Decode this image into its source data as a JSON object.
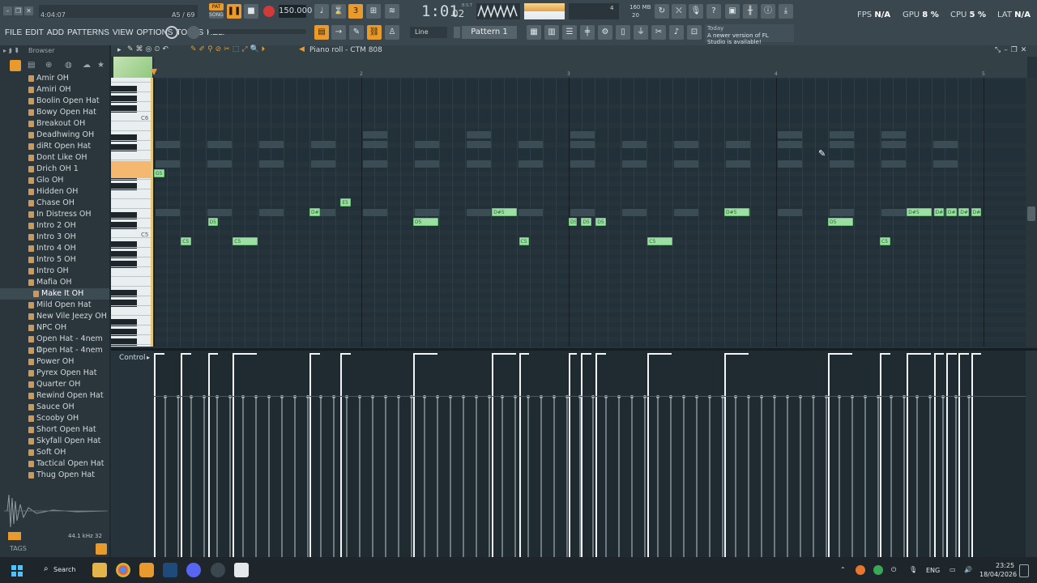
{
  "window": {
    "time_elapsed": "4:04:07",
    "hint_count": "A5 / 69"
  },
  "transport": {
    "pat_label": "PAT",
    "song_label": "SONG",
    "bpm": "150.000",
    "time": "1:01",
    "time_sub": "02",
    "time_hint": "B:S:T",
    "memory": "160 MB",
    "poly": "20",
    "cpu_meter": "4"
  },
  "menu": [
    "FILE",
    "EDIT",
    "ADD",
    "PATTERNS",
    "VIEW",
    "OPTIONS",
    "TOOLS",
    "HELP"
  ],
  "toolbar": {
    "snap": "Line",
    "pattern": "Pattern 1",
    "news_title": "Today",
    "news_text": "A newer version of FL Studio is available!"
  },
  "stats": {
    "fps_label": "FPS",
    "fps": "N/A",
    "gpu_label": "GPU",
    "gpu": "8 %",
    "cpu_label": "CPU",
    "cpu": "5 %",
    "lat_label": "LAT",
    "lat": "N/A"
  },
  "browser": {
    "title": "Browser",
    "items": [
      "Amir OH",
      "Amiri OH",
      "Boolin Open Hat",
      "Bowy Open Hat",
      "Breakout OH",
      "Deadhwing OH",
      "diRt Open Hat",
      "Dont Like OH",
      "Drich OH 1",
      "Glo OH",
      "Hidden OH",
      "Chase OH",
      "In Distress OH",
      "Intro 2 OH",
      "Intro 3 OH",
      "Intro 4 OH",
      "Intro 5 OH",
      "Intro OH",
      "Mafia OH",
      "Make It OH",
      "Mild Open Hat",
      "New Vile Jeezy OH",
      "NPC OH",
      "Open Hat - 4nem II",
      "Open Hat - 4nem",
      "Power OH",
      "Pyrex Open Hat",
      "Quarter OH",
      "Rewind Open Hat",
      "Sauce OH",
      "Scooby OH",
      "Short Open Hat",
      "Skyfall Open Hat",
      "Soft OH",
      "Tactical Open Hat",
      "Thug Open Hat"
    ],
    "selected_index": 19,
    "sample_info": "44.1 kHz 32",
    "tags_label": "TAGS"
  },
  "piano_roll": {
    "title": "Piano roll - CTM 808",
    "bar_numbers": [
      "2",
      "3",
      "4",
      "5"
    ],
    "key_labels": [
      "C6",
      "C5"
    ],
    "control_label": "Control",
    "notes": [
      {
        "label": "G5",
        "pitch": "G5",
        "start": 1.0,
        "len": 0.05
      },
      {
        "label": "D#5",
        "pitch": "D#5",
        "start": 1.75,
        "len": 0.05
      },
      {
        "label": "E5",
        "pitch": "E5",
        "start": 1.9,
        "len": 0.05
      },
      {
        "label": "D5",
        "pitch": "D5",
        "start": 1.26,
        "len": 0.05
      },
      {
        "label": "C5",
        "pitch": "C5",
        "start": 1.13,
        "len": 0.05
      },
      {
        "label": "C5",
        "pitch": "C5",
        "start": 1.38,
        "len": 0.12
      },
      {
        "label": "D5",
        "pitch": "D5",
        "start": 2.25,
        "len": 0.12
      },
      {
        "label": "D#5",
        "pitch": "D#5",
        "start": 2.63,
        "len": 0.12
      },
      {
        "label": "C5",
        "pitch": "C5",
        "start": 2.76,
        "len": 0.05
      },
      {
        "label": "D5",
        "pitch": "D5",
        "start": 3.0,
        "len": 0.02
      },
      {
        "label": "D5",
        "pitch": "D5",
        "start": 3.06,
        "len": 0.05
      },
      {
        "label": "D5",
        "pitch": "D5",
        "start": 3.13,
        "len": 0.05
      },
      {
        "label": "C5",
        "pitch": "C5",
        "start": 3.38,
        "len": 0.12
      },
      {
        "label": "D#5",
        "pitch": "D#5",
        "start": 3.75,
        "len": 0.12
      },
      {
        "label": "D5",
        "pitch": "D5",
        "start": 4.25,
        "len": 0.12
      },
      {
        "label": "C5",
        "pitch": "C5",
        "start": 4.5,
        "len": 0.05
      },
      {
        "label": "D#5",
        "pitch": "D#5",
        "start": 4.63,
        "len": 0.12
      },
      {
        "label": "D#5",
        "pitch": "D#5",
        "start": 4.76,
        "len": 0.05
      },
      {
        "label": "D#5",
        "pitch": "D#5",
        "start": 4.82,
        "len": 0.05
      },
      {
        "label": "D#5",
        "pitch": "D#5",
        "start": 4.88,
        "len": 0.05
      },
      {
        "label": "D#5",
        "pitch": "D#5",
        "start": 4.94,
        "len": 0.05
      }
    ]
  },
  "taskbar": {
    "search": "Search",
    "lang": "ENG",
    "time": "23:25",
    "date": "18/04/2026"
  }
}
